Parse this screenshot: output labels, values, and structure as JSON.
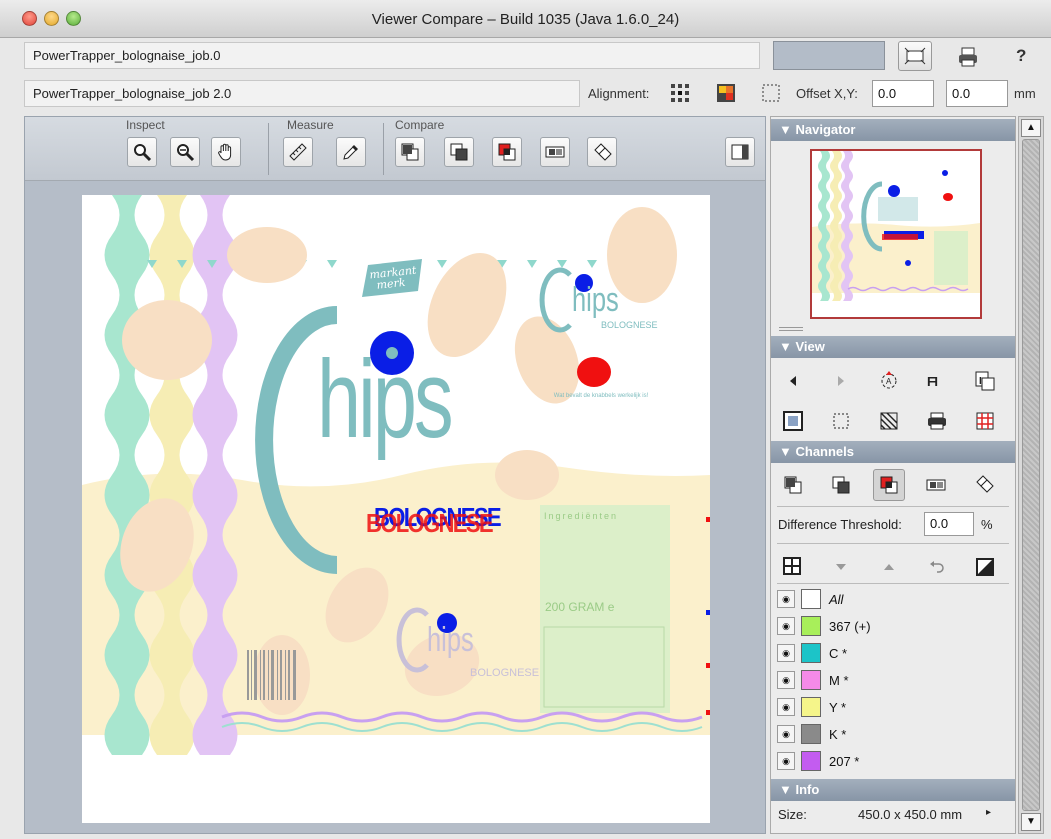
{
  "window": {
    "title": "Viewer Compare – Build 1035 (Java 1.6.0_24)"
  },
  "header": {
    "job1": "PowerTrapper_bolognaise_job.0",
    "job2": "PowerTrapper_bolognaise_job 2.0",
    "alignment_label": "Alignment:",
    "offset_label": "Offset X,Y:",
    "offset_x": "0.0",
    "offset_y": "0.0",
    "unit": "mm",
    "help": "?"
  },
  "toolbar": {
    "inspect_label": "Inspect",
    "measure_label": "Measure",
    "compare_label": "Compare"
  },
  "artwork": {
    "brand_line1": "markant",
    "brand_line2": "merk",
    "big_title": "hips",
    "small_title": "hips",
    "small_sub": "BOLOGNESE",
    "mid_title": "hips",
    "mid_sub": "BOLOGNESE",
    "banner_text": "BOLOGNESE",
    "ingredients_title": "Ingrediënten",
    "weight": "200 GRAM e",
    "tagline": "Wat bevalt de knabbels werkelijk is!"
  },
  "panel": {
    "navigator_title": "Navigator",
    "view_title": "View",
    "channels_title": "Channels",
    "threshold_label": "Difference Threshold:",
    "threshold_value": "0.0",
    "threshold_unit": "%",
    "info_title": "Info",
    "size_label": "Size:",
    "size_value": "450.0 x 450.0 mm",
    "channels": [
      {
        "name": "All",
        "color": "#ffffff"
      },
      {
        "name": "367 (+)",
        "color": "#a8ef5a"
      },
      {
        "name": "C *",
        "color": "#1cc4c8"
      },
      {
        "name": "M *",
        "color": "#f58ae8"
      },
      {
        "name": "Y *",
        "color": "#f5f58a"
      },
      {
        "name": "K *",
        "color": "#8a8a8a"
      },
      {
        "name": "207 *",
        "color": "#c35cf0"
      }
    ]
  },
  "colors": {
    "accent_teal": "#7fbdbf",
    "diff_blue": "#0a1ee6",
    "diff_red": "#f01010",
    "panel_header": "#8795a6"
  }
}
